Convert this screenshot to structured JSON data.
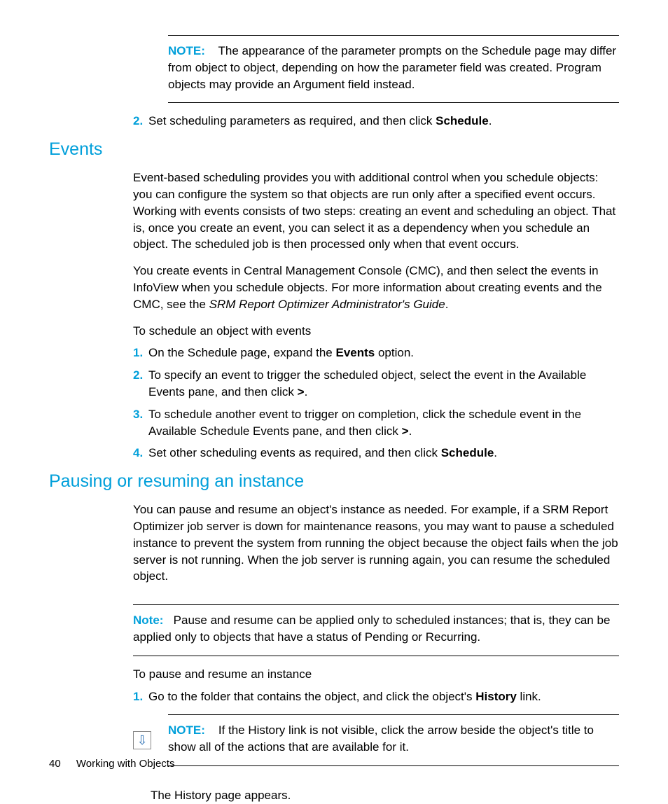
{
  "note1": {
    "label": "NOTE:",
    "text": "The appearance of the parameter prompts on the Schedule page may differ from object to object, depending on how the parameter field was created. Program objects may provide an Argument field instead."
  },
  "step2": {
    "num": "2.",
    "prefix": "Set scheduling parameters as required, and then click ",
    "bold": "Schedule",
    "suffix": "."
  },
  "events": {
    "heading": "Events",
    "para1": "Event-based scheduling provides you with additional control when you schedule objects: you can configure the system so that objects are run only after a specified event occurs. Working with events consists of two steps: creating an event and scheduling an object. That is, once you create an event, you can select it as a dependency when you schedule an object. The scheduled job is then processed only when that event occurs.",
    "para2_prefix": "You create events in Central Management Console (CMC), and then select the events in InfoView when you schedule objects. For more information about creating events and the CMC, see the ",
    "para2_italic": "SRM Report Optimizer Administrator's Guide",
    "para2_suffix": ".",
    "intro": "To schedule an object with events",
    "s1": {
      "num": "1.",
      "prefix": "On the Schedule page, expand the ",
      "bold": "Events",
      "suffix": " option."
    },
    "s2": {
      "num": "2.",
      "prefix": "To specify an event to trigger the scheduled object, select the event in the Available Events pane, and then click ",
      "bold": ">",
      "suffix": "."
    },
    "s3": {
      "num": "3.",
      "prefix": "To schedule another event to trigger on completion, click the schedule event in the Available Schedule Events pane, and then click ",
      "bold": ">",
      "suffix": "."
    },
    "s4": {
      "num": "4.",
      "prefix": "Set other scheduling events as required, and then click ",
      "bold": "Schedule",
      "suffix": "."
    }
  },
  "pausing": {
    "heading": "Pausing or resuming an instance",
    "para1": "You can pause and resume an object's instance as needed. For example, if a SRM Report Optimizer job server is down for maintenance reasons, you may want to pause a scheduled instance to prevent the system from running the object because the object fails when the job server is not running. When the job server is running again, you can resume the scheduled object.",
    "note_label": "Note:",
    "note_text": "Pause and resume can be applied only to scheduled instances; that is, they can be applied only to objects that have a status of Pending or Recurring.",
    "intro": "To pause and resume an instance",
    "s1": {
      "num": "1.",
      "prefix": "Go to the folder that contains the object, and click the object's ",
      "bold": "History",
      "suffix": " link."
    },
    "note2_label": "NOTE:",
    "note2_text": "If the History link is not visible, click the arrow beside the object's title to show all of the actions that are available for it.",
    "result": "The History page appears."
  },
  "footer": {
    "page": "40",
    "title": "Working with Objects"
  },
  "icons": {
    "arrow_down": "⇩"
  }
}
